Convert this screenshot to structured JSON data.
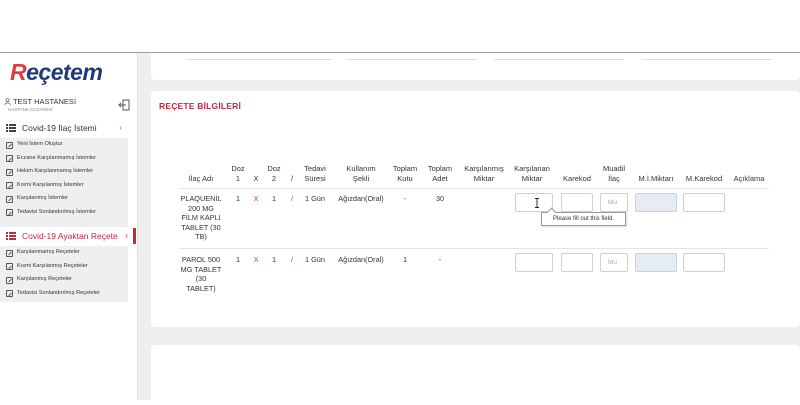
{
  "app": {
    "logo_first": "R",
    "logo_rest": "eçetem",
    "hospital_name": "TEST HASTANESİ",
    "hospital_sub": "HASTANE ECZANESİ"
  },
  "sidebar": {
    "menu1": {
      "label": "Covid-19 İlaç İstemi",
      "chevron": "‹",
      "items": [
        "Yeni İstem Oluştur",
        "Eczane Karşılanmamış İstemler",
        "Hekim Karşılanmamış İstemler",
        "Kısmi Karşılanmış İstemler",
        "Karşılanmış İstemler",
        "Tedavisi Sonlandırılmış İstemler"
      ]
    },
    "menu2": {
      "label": "Covid-19 Ayaktan Reçete",
      "chevron": "‹",
      "items": [
        "Karşılanmamış Reçeteler",
        "Kısmi Karşılanmış Reçeteler",
        "Karşılanmış Reçeteler",
        "Tedavisi Sonlandırılmış Reçeteler"
      ]
    }
  },
  "section": {
    "title": "REÇETE BİLGİLERİ"
  },
  "table": {
    "headers": {
      "ilac_adi": "İlaç Adı",
      "doz1": "Doz\n1",
      "x": "X",
      "doz2": "Doz\n2",
      "slash": "/",
      "tedavi": "Tedavi\nSüresi",
      "kullanim": "Kullanım\nŞekli",
      "toplam_kutu": "Toplam\nKutu",
      "toplam_adet": "Toplam\nAdet",
      "karsilanmis": "Karşılanmış\nMiktar",
      "karsilanan": "Karşılanan\nMiktar",
      "karekod": "Karekod",
      "muadil": "Muadil\nİlaç",
      "mi_miktari": "M.İ.Miktarı",
      "m_karekod": "M.Karekod",
      "aciklama": "Açıklama"
    },
    "rows": [
      {
        "ilac_adi": "PLAQUENİL\n200 MG\nFİLM KAPLI\nTABLET (30\nTB)",
        "doz1": "1",
        "x": "X",
        "doz2": "1",
        "slash": "/",
        "tedavi": "1 Gün",
        "kullanim": "Ağızdan(Oral)",
        "toplam_kutu": "-",
        "toplam_adet": "30",
        "muadil_placeholder": "Mu"
      },
      {
        "ilac_adi": "PAROL 500\nMG TABLET\n(30\nTABLET)",
        "doz1": "1",
        "x": "X",
        "doz2": "1",
        "slash": "/",
        "tedavi": "1 Gün",
        "kullanim": "Ağızdan(Oral)",
        "toplam_kutu": "1",
        "toplam_adet": "-",
        "muadil_placeholder": "Mu"
      }
    ]
  },
  "tooltip": {
    "text": "Please fill out this field."
  },
  "colors": {
    "brand_red": "#c4283d",
    "brand_blue": "#1e3a7a",
    "disabled_input": "#e6ecf3"
  }
}
